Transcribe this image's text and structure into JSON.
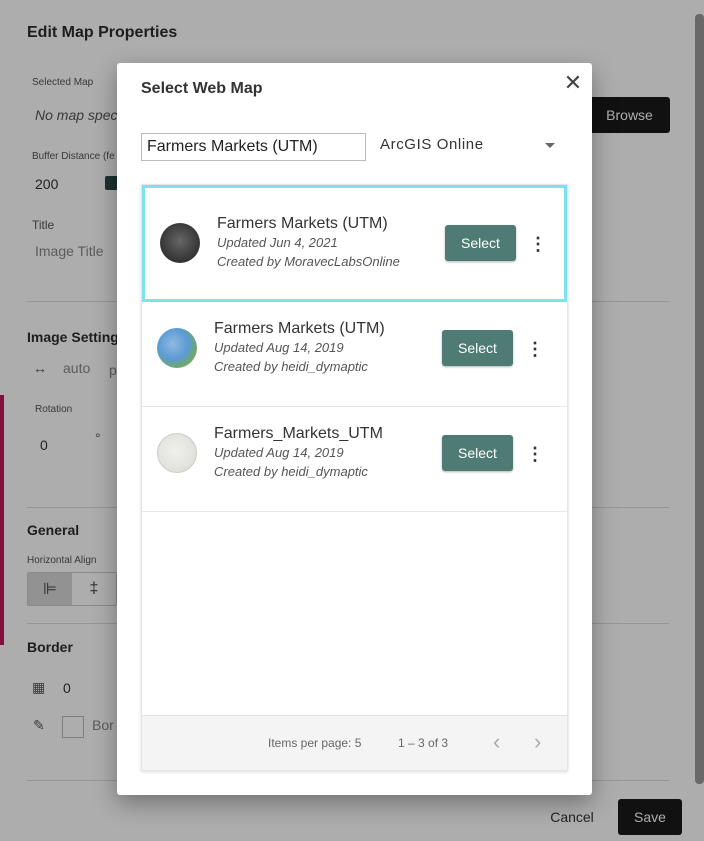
{
  "background": {
    "title": "Edit Map Properties",
    "selected_map_label": "Selected Map",
    "selected_map_value": "No map spec",
    "browse_label": "Browse",
    "buffer_label": "Buffer Distance (fe",
    "buffer_value": "200",
    "title_label": "Title",
    "title_placeholder": "Image Title",
    "image_settings_label": "Image Settings",
    "width_value": "auto",
    "width_unit": "p",
    "rotation_label": "Rotation",
    "rotation_value": "0",
    "rotation_unit": "°",
    "general_label": "General",
    "horizontal_align_label": "Horizontal Align",
    "border_label": "Border",
    "border_value": "0",
    "border_color_label": "Bor",
    "cancel_label": "Cancel",
    "save_label": "Save"
  },
  "dialog": {
    "title": "Select Web Map",
    "search_value": "Farmers Markets (UTM)",
    "source": "ArcGIS Online",
    "items": [
      {
        "title": "Farmers Markets (UTM)",
        "updated": "Updated Jun 4, 2021",
        "created": "Created by MoravecLabsOnline",
        "button": "Select",
        "thumb_color": "#3a3a3a"
      },
      {
        "title": "Farmers Markets (UTM)",
        "updated": "Updated Aug 14, 2019",
        "created": "Created by heidi_dymaptic",
        "button": "Select",
        "thumb_color": "#5b9bd5"
      },
      {
        "title": "Farmers_Markets_UTM",
        "updated": "Updated Aug 14, 2019",
        "created": "Created by heidi_dymaptic",
        "button": "Select",
        "thumb_color": "#e3e3de"
      }
    ],
    "footer": {
      "items_per_page": "Items per page: 5",
      "range": "1 – 3 of 3"
    }
  }
}
